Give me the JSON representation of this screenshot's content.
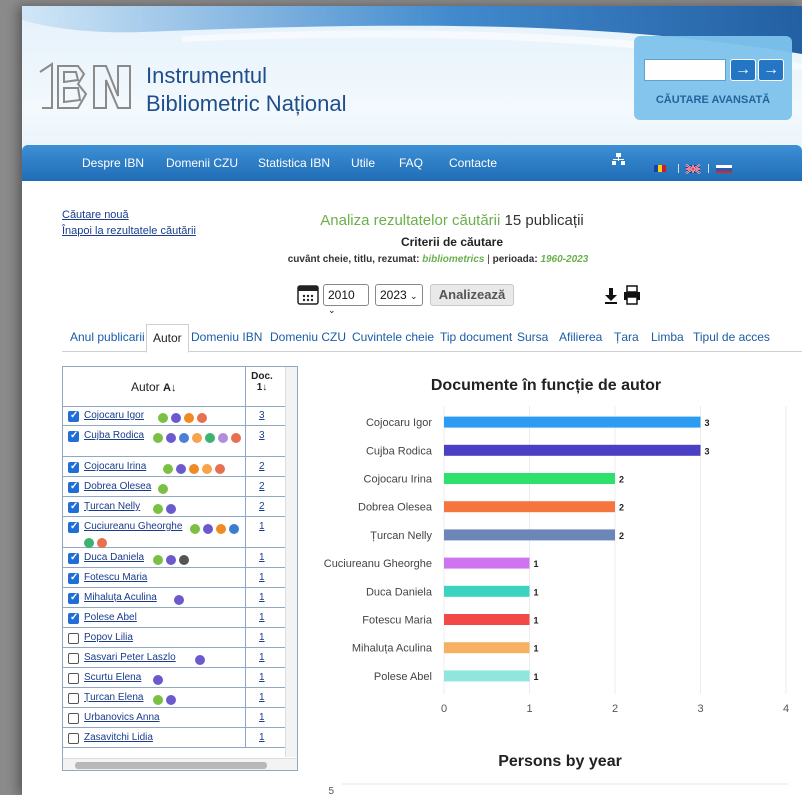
{
  "site": {
    "title_line1": "Instrumentul",
    "title_line2": "Bibliometric Național",
    "search_go_1": "→",
    "search_go_2": "→",
    "advanced_search": "CĂUTARE AVANSATĂ"
  },
  "nav": [
    "Despre IBN",
    "Domenii CZU",
    "Statistica IBN",
    "Utile",
    "FAQ",
    "Contacte"
  ],
  "links": {
    "new_search": "Căutare nouă",
    "back_to_results": "Înapoi la rezultatele căutării"
  },
  "analysis": {
    "heading": "Analiza rezultatelor căutării",
    "count_text": "15 publicații",
    "criteria_title": "Criterii de căutare",
    "criteria_fields_label": "cuvânt cheie, titlu, rezumat:",
    "criteria_keyword": "bibliometrics",
    "criteria_sep": "|",
    "criteria_period_label": "perioada:",
    "criteria_period": "1960-2023"
  },
  "controls": {
    "year_from": "2010",
    "year_to": "2023",
    "analyze_button": "Analizează"
  },
  "tabs": [
    "Anul publicarii",
    "Autor",
    "Domeniu IBN",
    "Domeniu CZU",
    "Cuvintele cheie",
    "Tip document",
    "Sursa",
    "Afilierea",
    "Țara",
    "Limba",
    "Tipul de acces"
  ],
  "active_tab": "Autor",
  "author_table": {
    "col_author": "Autor",
    "col_docs": "Doc.",
    "rows": [
      {
        "name": "Cojocaru Igor",
        "count": "3",
        "checked": true
      },
      {
        "name": "Cujba Rodica",
        "count": "3",
        "checked": true
      },
      {
        "name": "Cojocaru Irina",
        "count": "2",
        "checked": true
      },
      {
        "name": "Dobrea Olesea",
        "count": "2",
        "checked": true
      },
      {
        "name": "Țurcan Nelly",
        "count": "2",
        "checked": true
      },
      {
        "name": "Cuciureanu Gheorghe",
        "count": "1",
        "checked": true
      },
      {
        "name": "Duca Daniela",
        "count": "1",
        "checked": true
      },
      {
        "name": "Fotescu Maria",
        "count": "1",
        "checked": true
      },
      {
        "name": "Mihaluța Aculina",
        "count": "1",
        "checked": true
      },
      {
        "name": "Polese Abel",
        "count": "1",
        "checked": true
      },
      {
        "name": "Popov Lilia",
        "count": "1",
        "checked": false
      },
      {
        "name": "Sasvari Peter Laszlo",
        "count": "1",
        "checked": false
      },
      {
        "name": "Scurtu Elena",
        "count": "1",
        "checked": false
      },
      {
        "name": "Țurcan Elena",
        "count": "1",
        "checked": false
      },
      {
        "name": "Urbanovics Anna",
        "count": "1",
        "checked": false
      },
      {
        "name": "Zasavitchi Lidia",
        "count": "1",
        "checked": false
      }
    ]
  },
  "chart_data": [
    {
      "type": "bar",
      "orientation": "horizontal",
      "title": "Documente în funcție de autor",
      "categories": [
        "Cojocaru Igor",
        "Cujba Rodica",
        "Cojocaru Irina",
        "Dobrea Olesea",
        "Țurcan Nelly",
        "Cuciureanu Gheorghe",
        "Duca Daniela",
        "Fotescu Maria",
        "Mihaluța Aculina",
        "Polese Abel"
      ],
      "values": [
        3,
        3,
        2,
        2,
        2,
        1,
        1,
        1,
        1,
        1
      ],
      "colors": [
        "#2b9cf2",
        "#4b3fc4",
        "#2ee06c",
        "#f5753f",
        "#6d86b8",
        "#cf74f0",
        "#39d3c0",
        "#f24848",
        "#f7b062",
        "#8ee6df"
      ],
      "xlim": [
        0,
        4
      ],
      "xticks": [
        "0",
        "1",
        "2",
        "3",
        "4"
      ],
      "grid": true,
      "data_labels": true
    },
    {
      "type": "line",
      "title": "Persons by year",
      "yticks": [
        "5"
      ]
    }
  ],
  "colors": {
    "nav": "#1f6db6",
    "link": "#1a3c8c",
    "accent_green": "#6ab04c",
    "title_blue": "#1f4e8c"
  }
}
